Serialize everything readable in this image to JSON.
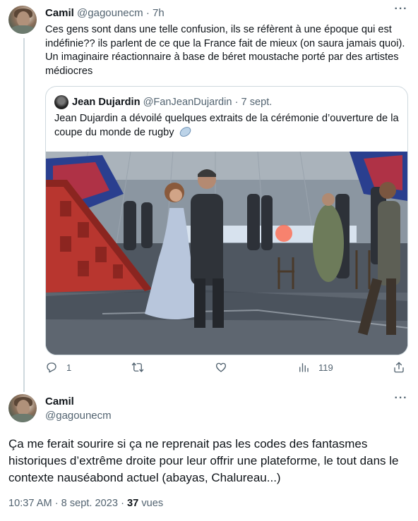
{
  "first_tweet": {
    "author_name": "Camil",
    "handle": "@gagounecm",
    "separator": "·",
    "time": "7h",
    "text": "Ces gens sont dans une telle confusion, ils se réfèrent à une époque qui est indéfinie?? ils parlent de ce que la France fait de mieux (on saura jamais quoi). Un imaginaire réactionnaire à base de béret moustache porté par des artistes médiocres",
    "quoted": {
      "author_name": "Jean Dujardin",
      "handle": "@FanJeanDujardin",
      "separator": "·",
      "date": "7 sept.",
      "text": "Jean Dujardin a dévoilé quelques extraits de la cérémonie d’ouverture de la coupe du monde de rugby",
      "emoji": "rugby-ball-icon"
    },
    "actions": {
      "replies": "1",
      "retweets": "",
      "likes": "",
      "views": "119"
    }
  },
  "second_tweet": {
    "author_name": "Camil",
    "handle": "@gagounecm",
    "text": "Ça me ferait sourire si ça ne reprenait pas les codes des fantasmes historiques d’extrême droite pour leur offrir une plateforme, le tout dans le contexte nauséabond actuel (abayas, Chalureau...)",
    "time": "10:37 AM",
    "separator": "·",
    "date": "8 sept. 2023",
    "separator2": "·",
    "views_count": "37",
    "views_label": "vues"
  },
  "colors": {
    "text": "#0f1419",
    "muted": "#536471",
    "border": "#cfd9de"
  }
}
